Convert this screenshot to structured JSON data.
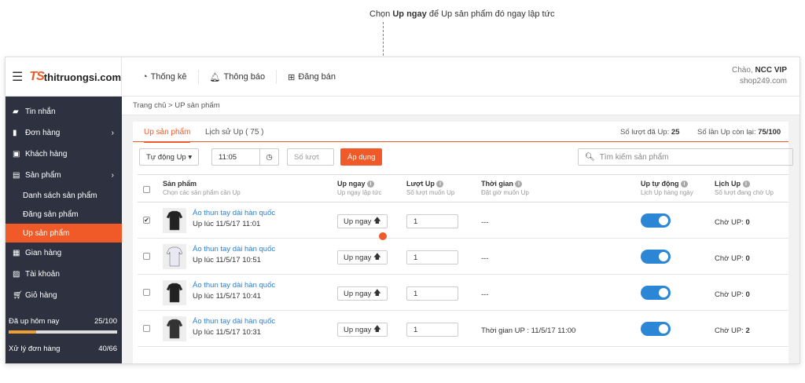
{
  "annotation": {
    "prefix": "Chọn ",
    "bold": "Up ngay",
    "suffix": " để Up sản phẩm đó ngay lập tức"
  },
  "brand": {
    "mark": "TS",
    "name": "thitruongsi.com"
  },
  "nav": [
    {
      "icon": "pie-chart-icon",
      "label": "Thống kê"
    },
    {
      "icon": "bell-icon",
      "label": "Thông báo"
    },
    {
      "icon": "plus-square-icon",
      "label": "Đăng bán"
    }
  ],
  "greeting": {
    "hello": "Chào, ",
    "user": "NCC VIP",
    "shop": "shop249.com"
  },
  "sidebar": {
    "items": [
      {
        "icon": "chat-icon",
        "label": "Tin nhắn"
      },
      {
        "icon": "document-icon",
        "label": "Đơn hàng"
      },
      {
        "icon": "contacts-icon",
        "label": "Khách hàng"
      },
      {
        "icon": "box-icon",
        "label": "Sản phẩm"
      }
    ],
    "subitems": [
      "Danh sách sản phẩm",
      "Đăng sản phẩm",
      "Up sản phẩm"
    ],
    "items2": [
      {
        "icon": "store-icon",
        "label": "Gian hàng"
      },
      {
        "icon": "user-icon",
        "label": "Tài khoản"
      },
      {
        "icon": "cart-icon",
        "label": "Giỏ hàng"
      }
    ],
    "stats": [
      {
        "label": "Đã up hôm nay",
        "value": "25/100",
        "fraction": 0.25
      },
      {
        "label": "Xử lý đơn hàng",
        "value": "40/66"
      }
    ]
  },
  "breadcrumb": "Trang chủ > UP sản phẩm",
  "tabs": {
    "active": "Up sản phẩm",
    "history": "Lịch sử Up ( 75 )"
  },
  "counts": {
    "used_label": "Số lượt đã Up: ",
    "used": "25",
    "left_label": "Số lần Up còn lại: ",
    "left": "75/100"
  },
  "toolbar": {
    "auto": "Tự động Up ▾",
    "time": "11:05",
    "count_placeholder": "Số lượt",
    "apply": "Áp dụng",
    "search_placeholder": "Tìm kiếm sản phẩm"
  },
  "columns": {
    "product": "Sản phẩm",
    "product_sub": "Chọn các sản phẩm cần Up",
    "upnow": "Up ngay",
    "upnow_sub": "Up ngay lập tức",
    "count": "Lượt Up",
    "count_sub": "Số lượt muốn Up",
    "time": "Thời gian",
    "time_sub": "Đặt giờ muốn Up",
    "auto": "Up tự động",
    "auto_sub": "Lịch Up hàng ngày",
    "sched": "Lịch Up",
    "sched_sub": "Số lượt đang chờ Up"
  },
  "rows": [
    {
      "checked": true,
      "name": "Áo thun tay dài hàn quốc",
      "uptime": "Up lúc 11/5/17 11:01",
      "upbtn": "Up ngay",
      "qty": "1",
      "time": "---",
      "auto": true,
      "sched_label": "Chờ UP: ",
      "sched": "0"
    },
    {
      "checked": false,
      "name": "Áo thun tay dài hàn quốc",
      "uptime": "Up lúc 11/5/17 10:51",
      "upbtn": "Up ngay",
      "qty": "1",
      "time": "---",
      "auto": true,
      "sched_label": "Chờ UP: ",
      "sched": "0"
    },
    {
      "checked": false,
      "name": "Áo thun tay dài hàn quốc",
      "uptime": "Up lúc 11/5/17 10:41",
      "upbtn": "Up ngay",
      "qty": "1",
      "time": "---",
      "auto": true,
      "sched_label": "Chờ UP: ",
      "sched": "0"
    },
    {
      "checked": false,
      "name": "Áo thun tay dài hàn quốc",
      "uptime": "Up lúc 11/5/17 10:31",
      "upbtn": "Up ngay",
      "qty": "1",
      "time": "Thời gian UP : 11/5/17 11:00",
      "auto": true,
      "sched_label": "Chờ UP: ",
      "sched": "2"
    }
  ],
  "colors": {
    "accent": "#f05a28",
    "toggle": "#2b86d6",
    "sidebar": "#2e3240",
    "link": "#2a7fd4"
  }
}
